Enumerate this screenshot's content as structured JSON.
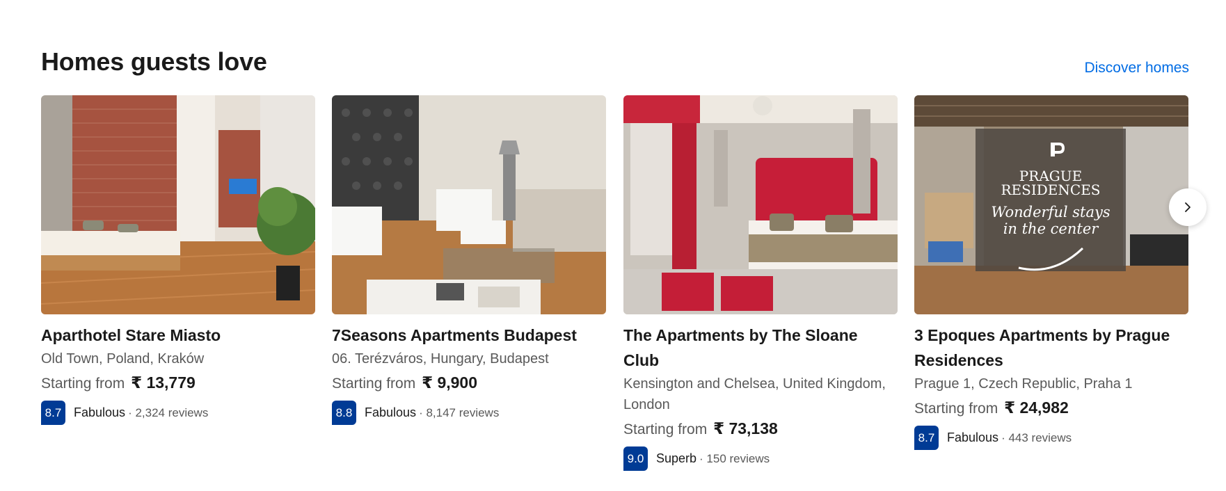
{
  "section": {
    "title": "Homes guests love",
    "discover_label": "Discover homes"
  },
  "cards": [
    {
      "title": "Aparthotel Stare Miasto",
      "location": "Old Town, Poland, Kraków",
      "price_prefix": "Starting from",
      "price": "₹ 13,779",
      "score": "8.7",
      "score_word": "Fabulous",
      "reviews": "· 2,324 reviews"
    },
    {
      "title": "7Seasons Apartments Budapest",
      "location": "06. Terézváros, Hungary, Budapest",
      "price_prefix": "Starting from",
      "price": "₹ 9,900",
      "score": "8.8",
      "score_word": "Fabulous",
      "reviews": "· 8,147 reviews"
    },
    {
      "title": "The Apartments by The Sloane Club",
      "location": "Kensington and Chelsea, United Kingdom, London",
      "price_prefix": "Starting from",
      "price": "₹ 73,138",
      "score": "9.0",
      "score_word": "Superb",
      "reviews": "· 150 reviews"
    },
    {
      "title": "3 Epoques Apartments by Prague Residences",
      "location": "Prague 1, Czech Republic, Praha 1",
      "price_prefix": "Starting from",
      "price": "₹ 24,982",
      "score": "8.7",
      "score_word": "Fabulous",
      "reviews": "· 443 reviews",
      "photo_overlay": {
        "brand_line1": "PRAGUE",
        "brand_line2": "RESIDENCES",
        "tagline_line1": "Wonderful stays",
        "tagline_line2": "in the center"
      }
    }
  ],
  "icons": {
    "next": "chevron-right-icon"
  },
  "colors": {
    "link": "#006ce4",
    "score_badge": "#003b95"
  }
}
